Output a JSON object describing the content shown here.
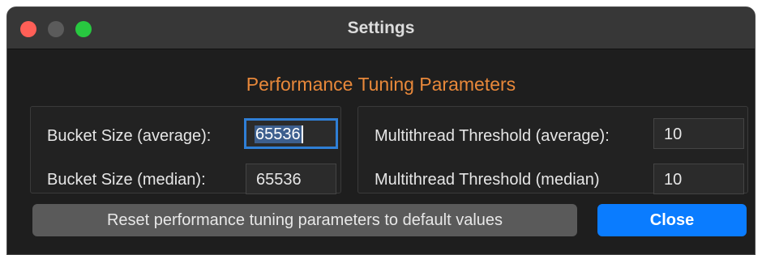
{
  "window": {
    "title": "Settings",
    "traffic_lights": {
      "close_color": "#ff5f57",
      "minimize_color": "#5b5b5b",
      "zoom_color": "#28c840"
    }
  },
  "heading": "Performance Tuning Parameters",
  "colors": {
    "heading": "#e8883a",
    "accent": "#0a7cff",
    "focus_ring": "#2f7fd6"
  },
  "bucket": {
    "average": {
      "label": "Bucket Size (average):",
      "value": "65536",
      "focused": true
    },
    "median": {
      "label": "Bucket Size (median):",
      "value": "65536"
    }
  },
  "multithread": {
    "average": {
      "label": "Multithread Threshold (average):",
      "value": "10"
    },
    "median": {
      "label": "Multithread Threshold (median)",
      "value": "10"
    }
  },
  "buttons": {
    "reset_label": "Reset performance tuning parameters to default values",
    "close_label": "Close"
  }
}
